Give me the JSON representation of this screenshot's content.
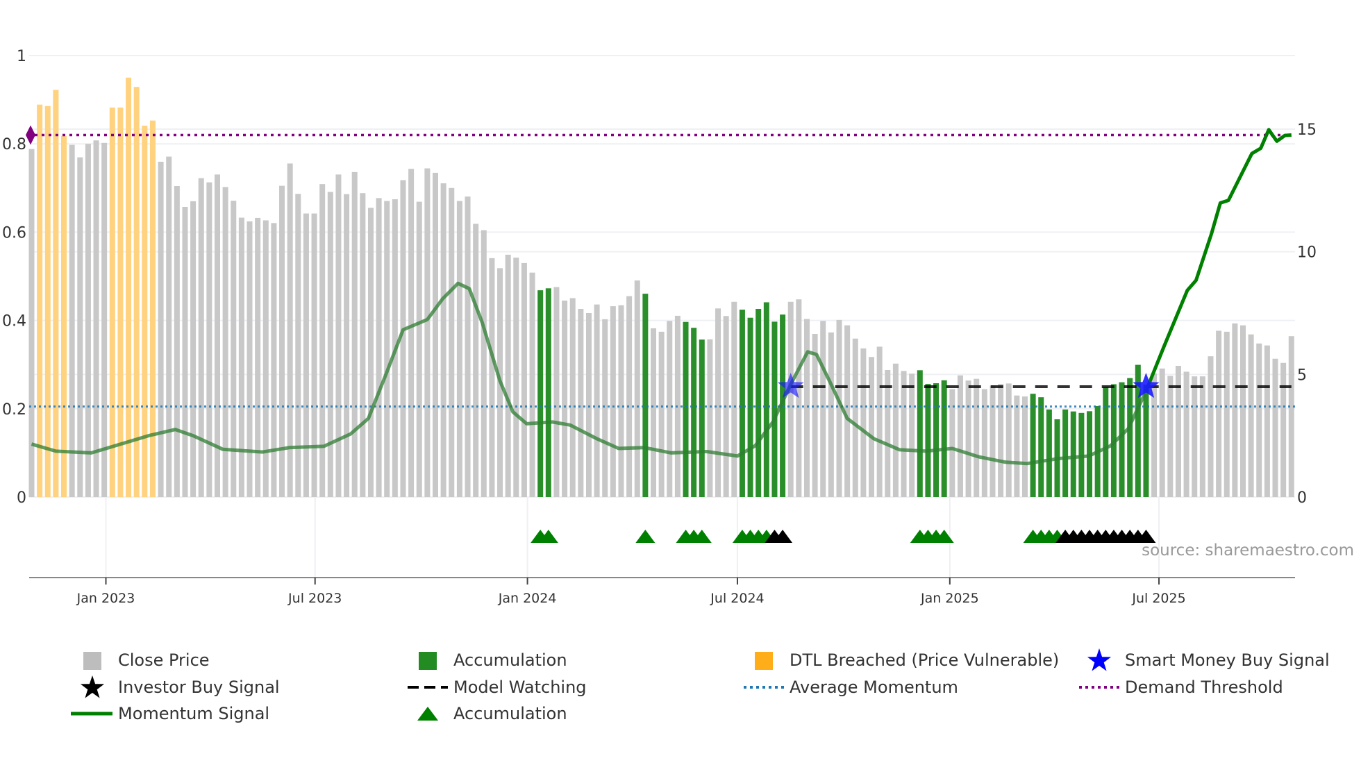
{
  "chart_data": {
    "type": "bar",
    "title": "",
    "source": "source: sharemaestro.com",
    "x_ticks": [
      {
        "label": "Jan 2023",
        "week_index": 10.2
      },
      {
        "label": "Jul 2023",
        "week_index": 36.1
      },
      {
        "label": "Jan 2024",
        "week_index": 62.4
      },
      {
        "label": "Jul 2024",
        "week_index": 88.4
      },
      {
        "label": "Jan 2025",
        "week_index": 114.7
      },
      {
        "label": "Jul 2025",
        "week_index": 140.6
      }
    ],
    "left_axis": {
      "range": [
        0,
        1
      ],
      "ticks": [
        "0",
        "0.2",
        "0.4",
        "0.6",
        "0.8",
        "1"
      ]
    },
    "right_axis": {
      "range": [
        0,
        15
      ],
      "ticks": [
        "0",
        "5",
        "10",
        "15"
      ]
    },
    "close_price": [
      14.19,
      16.0,
      15.94,
      16.6,
      14.72,
      14.36,
      13.85,
      14.4,
      14.54,
      14.44,
      15.88,
      15.88,
      17.1,
      16.72,
      15.14,
      15.35,
      13.67,
      13.88,
      12.68,
      11.83,
      12.06,
      13.0,
      12.83,
      13.15,
      12.64,
      12.08,
      11.39,
      11.24,
      11.38,
      11.28,
      11.17,
      12.69,
      13.6,
      12.36,
      11.56,
      11.56,
      12.76,
      12.44,
      13.15,
      12.35,
      13.25,
      12.39,
      11.79,
      12.19,
      12.07,
      12.14,
      12.92,
      13.38,
      12.04,
      13.4,
      13.22,
      12.79,
      12.6,
      12.07,
      12.25,
      11.14,
      10.88,
      9.74,
      9.33,
      9.88,
      9.76,
      9.54,
      9.15,
      8.43,
      8.51,
      8.56,
      8.01,
      8.11,
      7.67,
      7.5,
      7.85,
      7.25,
      7.78,
      7.82,
      8.19,
      8.83,
      8.29,
      6.88,
      6.74,
      7.18,
      7.39,
      7.14,
      6.9,
      6.42,
      6.43,
      7.69,
      7.38,
      7.96,
      7.64,
      7.31,
      7.67,
      7.94,
      7.15,
      7.44,
      7.96,
      8.06,
      7.26,
      6.65,
      7.18,
      6.71,
      7.22,
      7.0,
      6.46,
      6.06,
      5.71,
      6.13,
      5.18,
      5.44,
      5.14,
      5.03,
      5.17,
      4.61,
      4.64,
      4.76,
      4.4,
      4.96,
      4.75,
      4.82,
      4.4,
      4.54,
      4.61,
      4.63,
      4.14,
      4.1,
      4.21,
      4.07,
      3.57,
      3.17,
      3.57,
      3.49,
      3.43,
      3.5,
      3.71,
      4.49,
      4.6,
      4.68,
      4.85,
      5.39,
      4.58,
      5.04,
      5.24,
      4.94,
      5.35,
      5.11,
      4.92,
      4.92,
      5.74,
      6.78,
      6.74,
      7.08,
      7.0,
      6.63,
      6.26,
      6.18,
      5.64,
      5.47,
      6.56
    ],
    "dtl_breached_weeks": [
      2,
      3,
      4,
      5,
      11,
      12,
      13,
      14,
      15,
      16
    ],
    "accumulation_weeks": [
      64,
      65,
      77,
      82,
      83,
      84,
      89,
      90,
      91,
      92,
      93,
      94,
      111,
      112,
      113,
      114,
      125,
      126,
      127,
      128,
      129,
      130,
      131,
      132,
      133,
      134,
      135,
      136,
      137,
      138,
      139
    ],
    "investor_buy_weeks": [
      93,
      94,
      129,
      130,
      131,
      132,
      133,
      134,
      135,
      136,
      137,
      138,
      139
    ],
    "smart_money_buy": [
      {
        "week": 95,
        "value": 0.25
      },
      {
        "week": 139,
        "value": 0.25
      }
    ],
    "model_watching": {
      "from_week": 95,
      "to_week": 157,
      "value": 0.25
    },
    "average_momentum": 0.205,
    "demand_threshold": 0.82,
    "momentum_highlight_from_week": 139,
    "momentum_signal": [
      [
        1,
        0.12
      ],
      [
        4,
        0.104
      ],
      [
        8.4,
        0.1
      ],
      [
        15.5,
        0.139
      ],
      [
        18.8,
        0.153
      ],
      [
        21,
        0.139
      ],
      [
        24.7,
        0.108
      ],
      [
        29.6,
        0.102
      ],
      [
        32.9,
        0.112
      ],
      [
        37.2,
        0.115
      ],
      [
        40.5,
        0.143
      ],
      [
        42.7,
        0.178
      ],
      [
        44.9,
        0.279
      ],
      [
        47,
        0.379
      ],
      [
        50,
        0.402
      ],
      [
        51.9,
        0.449
      ],
      [
        53.8,
        0.484
      ],
      [
        55.2,
        0.472
      ],
      [
        56.8,
        0.395
      ],
      [
        59,
        0.263
      ],
      [
        60.6,
        0.193
      ],
      [
        62.3,
        0.166
      ],
      [
        65.5,
        0.17
      ],
      [
        67.7,
        0.163
      ],
      [
        71,
        0.132
      ],
      [
        73.7,
        0.11
      ],
      [
        76.9,
        0.112
      ],
      [
        80.2,
        0.1
      ],
      [
        84.6,
        0.103
      ],
      [
        88.4,
        0.093
      ],
      [
        90.6,
        0.116
      ],
      [
        92.8,
        0.17
      ],
      [
        95,
        0.255
      ],
      [
        97.1,
        0.329
      ],
      [
        98.2,
        0.323
      ],
      [
        99.8,
        0.263
      ],
      [
        102,
        0.178
      ],
      [
        105.3,
        0.132
      ],
      [
        108.5,
        0.107
      ],
      [
        111.8,
        0.104
      ],
      [
        115,
        0.11
      ],
      [
        118.3,
        0.091
      ],
      [
        121.6,
        0.079
      ],
      [
        124.3,
        0.076
      ],
      [
        128.1,
        0.087
      ],
      [
        131.9,
        0.093
      ],
      [
        134.6,
        0.116
      ],
      [
        136.8,
        0.155
      ],
      [
        139,
        0.24
      ],
      [
        141.2,
        0.34
      ],
      [
        144.1,
        0.468
      ],
      [
        145.2,
        0.491
      ],
      [
        147.1,
        0.596
      ],
      [
        148.2,
        0.666
      ],
      [
        149.2,
        0.672
      ],
      [
        152.1,
        0.778
      ],
      [
        153.2,
        0.79
      ],
      [
        154.2,
        0.832
      ],
      [
        155.2,
        0.806
      ],
      [
        156.2,
        0.819
      ],
      [
        157,
        0.82
      ]
    ],
    "legend": [
      {
        "label": "Close Price",
        "symbol": "square",
        "color": "#bdbdbd"
      },
      {
        "label": "Accumulation",
        "symbol": "square",
        "color": "#228b22"
      },
      {
        "label": "DTL Breached (Price Vulnerable)",
        "symbol": "square",
        "color": "#ffae1a"
      },
      {
        "label": "Smart Money Buy Signal",
        "symbol": "star",
        "color": "#0000ff"
      },
      {
        "label": "Investor Buy Signal",
        "symbol": "star",
        "color": "#000000"
      },
      {
        "label": "Model Watching",
        "symbol": "dash",
        "color": "#000000"
      },
      {
        "label": "Average Momentum",
        "symbol": "dot",
        "color": "#1f77b4"
      },
      {
        "label": "Demand Threshold",
        "symbol": "dot",
        "color": "#800080"
      },
      {
        "label": "Momentum Signal",
        "symbol": "line",
        "color": "#008000"
      },
      {
        "label": "Accumulation",
        "symbol": "triangle",
        "color": "#008000"
      }
    ],
    "colors": {
      "close": "#c8c8c8",
      "dtl": "#ffd27f",
      "accum_bar": "#2a8f2a",
      "momentum": "#008000",
      "threshold": "#800080",
      "avg": "#1f77b4"
    }
  }
}
